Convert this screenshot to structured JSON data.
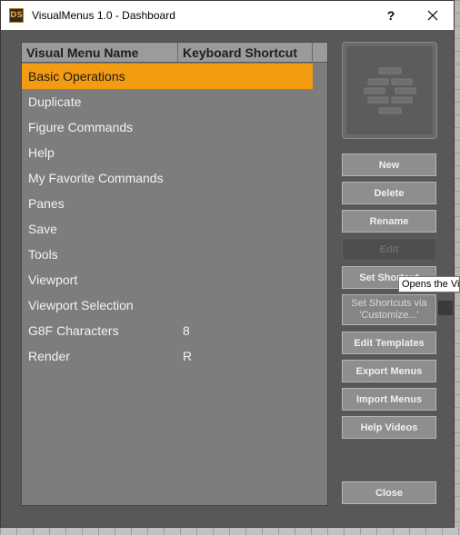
{
  "window": {
    "app_icon_text": "DS",
    "title": "VisualMenus 1.0 - Dashboard",
    "help_label": "?",
    "close_label": "✕"
  },
  "list": {
    "headers": {
      "name": "Visual Menu Name",
      "shortcut": "Keyboard Shortcut"
    },
    "rows": [
      {
        "name": "Basic Operations",
        "shortcut": "",
        "selected": true
      },
      {
        "name": "Duplicate",
        "shortcut": ""
      },
      {
        "name": "Figure Commands",
        "shortcut": ""
      },
      {
        "name": "Help",
        "shortcut": ""
      },
      {
        "name": "My Favorite Commands",
        "shortcut": ""
      },
      {
        "name": "Panes",
        "shortcut": ""
      },
      {
        "name": "Save",
        "shortcut": ""
      },
      {
        "name": "Tools",
        "shortcut": ""
      },
      {
        "name": "Viewport",
        "shortcut": ""
      },
      {
        "name": "Viewport Selection",
        "shortcut": ""
      },
      {
        "name": "G8F Characters",
        "shortcut": "8"
      },
      {
        "name": "Render",
        "shortcut": "R"
      }
    ]
  },
  "buttons": {
    "new": "New",
    "delete": "Delete",
    "rename": "Rename",
    "edit": "Edit",
    "set_shortcut": "Set Shortcut",
    "set_shortcuts_via_line1": "Set Shortcuts via",
    "set_shortcuts_via_line2": "'Customize...'",
    "edit_templates": "Edit Templates",
    "export_menus": "Export Menus",
    "import_menus": "Import Menus",
    "help_videos": "Help Videos",
    "close": "Close"
  },
  "tooltip": "Opens the Vi",
  "colors": {
    "selected_row": "#f39c12",
    "window_bg": "#585858",
    "list_bg": "#7d7d7d"
  }
}
